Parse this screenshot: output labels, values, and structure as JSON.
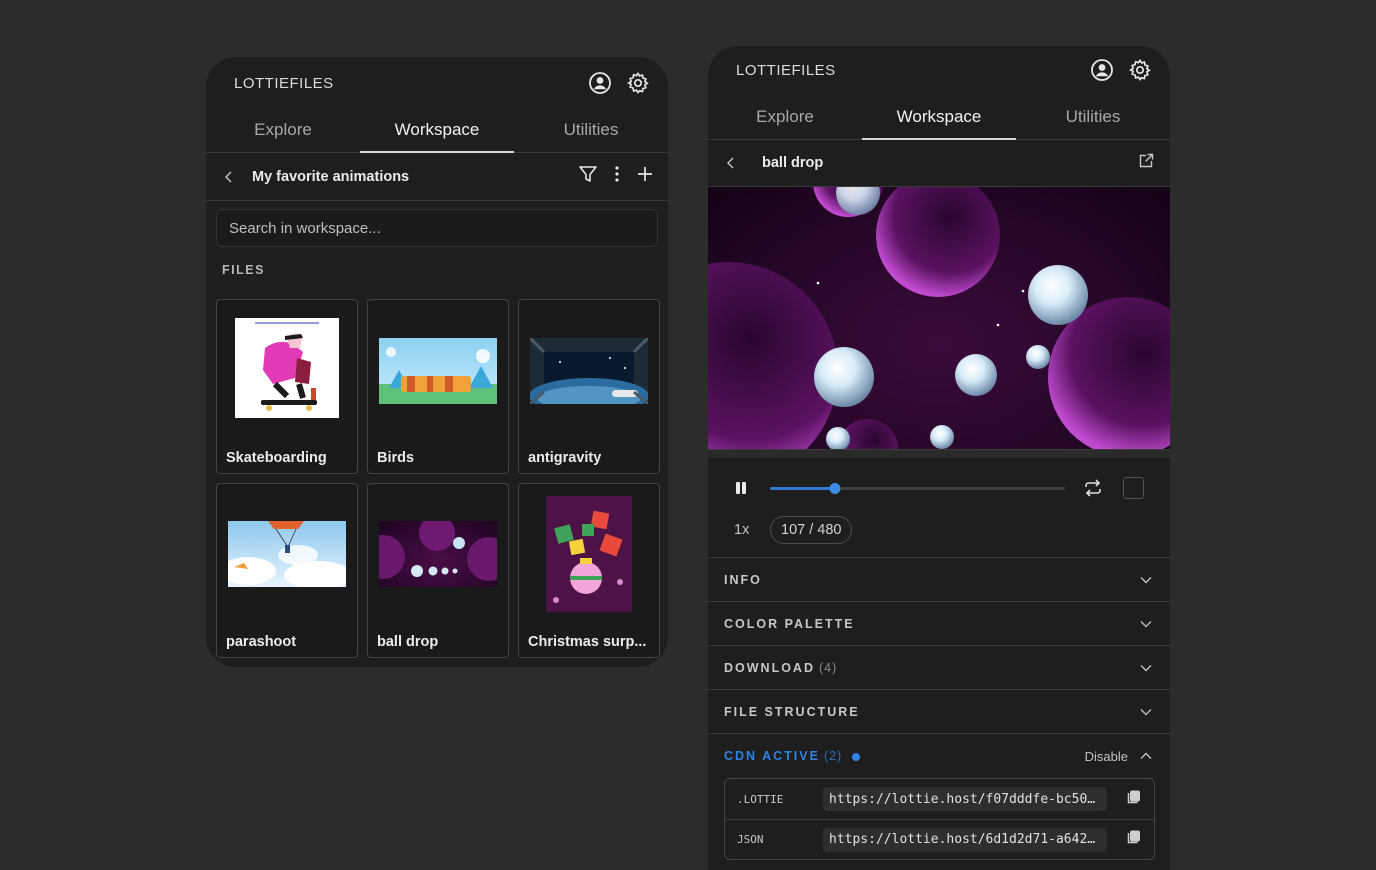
{
  "left": {
    "brand": "LOTTIEFILES",
    "tabs": [
      "Explore",
      "Workspace",
      "Utilities"
    ],
    "folder_title": "My favorite animations",
    "search_placeholder": "Search in workspace...",
    "section_label": "FILES",
    "files": [
      {
        "name": "Skateboarding"
      },
      {
        "name": "Birds"
      },
      {
        "name": "antigravity"
      },
      {
        "name": "parashoot"
      },
      {
        "name": "ball drop"
      },
      {
        "name": "Christmas surp..."
      }
    ]
  },
  "right": {
    "brand": "LOTTIEFILES",
    "tabs": [
      "Explore",
      "Workspace",
      "Utilities"
    ],
    "file_title": "ball drop",
    "player": {
      "progress_fraction": 0.22,
      "speed": "1x",
      "frame_current": "107",
      "frame_total": "480",
      "frames_label": "107 / 480"
    },
    "sections": {
      "info": "INFO",
      "color_palette": "COLOR PALETTE",
      "download": "DOWNLOAD",
      "download_count": "(4)",
      "file_structure": "FILE STRUCTURE",
      "cdn": "CDN ACTIVE",
      "cdn_count": "(2)",
      "disable": "Disable"
    },
    "cdn_links": [
      {
        "type": ".LOTTIE",
        "url": "https://lottie.host/f07dddfe-bc50…"
      },
      {
        "type": "JSON",
        "url": "https://lottie.host/6d1d2d71-a642…"
      }
    ]
  },
  "colors": {
    "background": "#2c2c2c",
    "panel": "#1e1e1e",
    "accent": "#2d84e6"
  }
}
